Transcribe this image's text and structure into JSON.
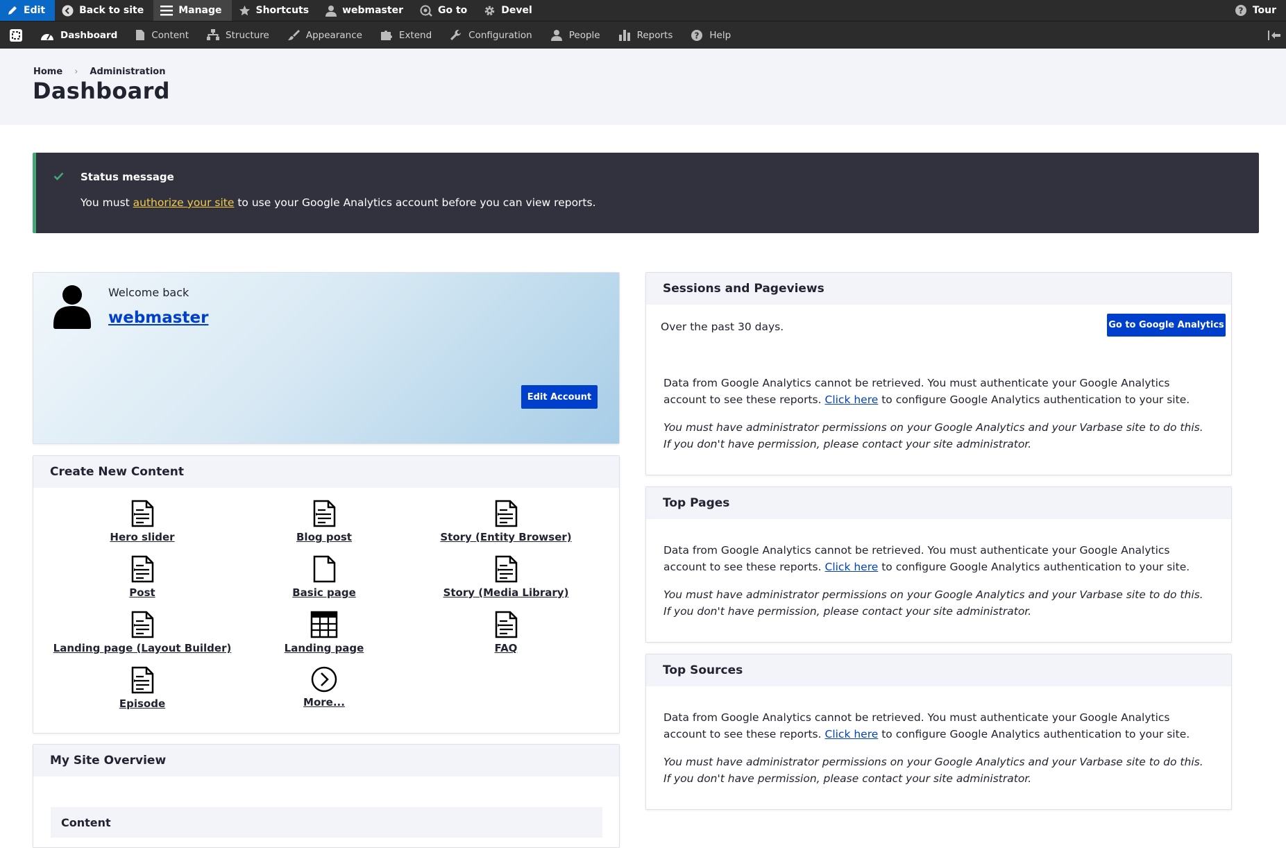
{
  "toolbar": {
    "edit": "Edit",
    "back": "Back to site",
    "manage": "Manage",
    "shortcuts": "Shortcuts",
    "user": "webmaster",
    "goto": "Go to",
    "devel": "Devel",
    "tour": "Tour"
  },
  "menu": {
    "dashboard": "Dashboard",
    "content": "Content",
    "structure": "Structure",
    "appearance": "Appearance",
    "extend": "Extend",
    "configuration": "Configuration",
    "people": "People",
    "reports": "Reports",
    "help": "Help"
  },
  "breadcrumb": {
    "home": "Home",
    "separator": "›",
    "admin": "Administration"
  },
  "page": {
    "title": "Dashboard"
  },
  "status": {
    "title": "Status message",
    "before": "You must ",
    "link": "authorize your site",
    "after": " to use your Google Analytics account before you can view reports."
  },
  "welcome": {
    "greeting": "Welcome back",
    "username": "webmaster",
    "edit_button": "Edit Account"
  },
  "create": {
    "title": "Create New Content",
    "items": [
      {
        "label": "Hero slider",
        "icon": "document-icon"
      },
      {
        "label": "Blog post",
        "icon": "document-icon"
      },
      {
        "label": "Story (Entity Browser)",
        "icon": "document-icon"
      },
      {
        "label": "Post",
        "icon": "document-icon"
      },
      {
        "label": "Basic page",
        "icon": "blank-page-icon"
      },
      {
        "label": "Story (Media Library)",
        "icon": "document-icon"
      },
      {
        "label": "Landing page (Layout Builder)",
        "icon": "document-icon"
      },
      {
        "label": "Landing page",
        "icon": "table-icon"
      },
      {
        "label": "FAQ",
        "icon": "document-icon"
      },
      {
        "label": "Episode",
        "icon": "document-icon"
      },
      {
        "label": "More...",
        "icon": "chevron-circle-icon"
      }
    ]
  },
  "overview": {
    "title": "My Site Overview",
    "content_heading": "Content"
  },
  "sessions": {
    "title": "Sessions and Pageviews",
    "period": "Over the past 30 days.",
    "button": "Go to Google Analytics"
  },
  "top_pages": {
    "title": "Top Pages"
  },
  "top_sources": {
    "title": "Top Sources"
  },
  "ga_message": {
    "before": "Data from Google Analytics cannot be retrieved. You must authenticate your Google Analytics account to see these reports. ",
    "link": "Click here",
    "after": " to configure Google Analytics authentication to your site.",
    "note": "You must have administrator permissions on your Google Analytics and your Varbase site to do this. If you don't have permission, please contact your site administrator."
  },
  "colors": {
    "toolbar_bg": "#2c2c2c",
    "edit_blue": "#0a69c6",
    "primary_button": "#003ecc",
    "status_bg": "#32323e",
    "status_accent": "#42a877",
    "status_link": "#f4cc46",
    "panel_header": "#f3f4f9"
  }
}
